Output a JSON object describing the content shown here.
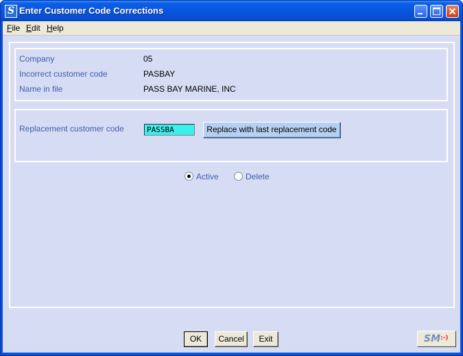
{
  "window": {
    "title": "Enter Customer Code Corrections",
    "app_icon_letter": "S"
  },
  "menu": {
    "items": [
      {
        "label": "File",
        "accel": "F",
        "rest": "ile"
      },
      {
        "label": "Edit",
        "accel": "E",
        "rest": "dit"
      },
      {
        "label": "Help",
        "accel": "H",
        "rest": "elp"
      }
    ]
  },
  "info": {
    "company_label": "Company",
    "company_value": "05",
    "incorrect_label": "Incorrect customer code",
    "incorrect_value": "PASBAY",
    "name_label": "Name in file",
    "name_value": "PASS BAY MARINE, INC"
  },
  "replacement": {
    "label": "Replacement customer code",
    "value": "PASSBA",
    "button_label": "Replace with last replacement code"
  },
  "status": {
    "active_label": "Active",
    "delete_label": "Delete",
    "selected": "Active"
  },
  "buttons": {
    "ok": "OK",
    "cancel": "Cancel",
    "exit": "Exit"
  },
  "logo": {
    "text": "SM",
    "smiley": ":-)"
  },
  "colors": {
    "title_bar": "#0a52d8",
    "client_bg": "#d6dcf4",
    "label_text": "#3d5fa8",
    "input_bg": "#3cf0ec",
    "replace_button_bg": "#b6d0f0"
  },
  "icons": [
    "minimize-icon",
    "maximize-icon",
    "close-icon"
  ]
}
